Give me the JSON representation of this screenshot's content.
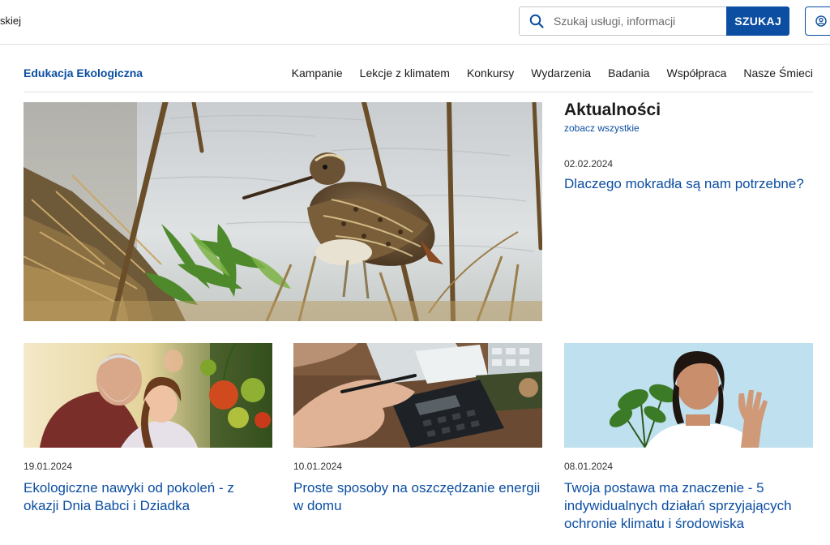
{
  "header": {
    "site_fragment": "skiej",
    "search": {
      "placeholder": "Szukaj usługi, informacji",
      "button_label": "SZUKAJ"
    }
  },
  "nav": {
    "brand": "Edukacja Ekologiczna",
    "items": [
      {
        "label": "Kampanie"
      },
      {
        "label": "Lekcje z klimatem"
      },
      {
        "label": "Konkursy"
      },
      {
        "label": "Wydarzenia"
      },
      {
        "label": "Badania"
      },
      {
        "label": "Współpraca"
      },
      {
        "label": "Nasze Śmieci"
      }
    ]
  },
  "news": {
    "heading": "Aktualności",
    "see_all": "zobacz wszystkie",
    "featured": {
      "date": "02.02.2024",
      "title": "Dlaczego mokradła są nam potrzebne?"
    }
  },
  "articles": [
    {
      "date": "19.01.2024",
      "title": "Ekologiczne nawyki od pokoleń - z okazji Dnia Babci i Dziadka"
    },
    {
      "date": "10.01.2024",
      "title": "Proste sposoby na oszczędzanie energii w domu"
    },
    {
      "date": "08.01.2024",
      "title": "Twoja postawa ma znaczenie - 5 indywidualnych działań sprzyjających ochronie klimatu i środowiska"
    }
  ],
  "colors": {
    "accent": "#0b4ea2",
    "text": "#1b1b1b",
    "divider": "#e3e3e3"
  },
  "icons": {
    "search": "search-icon",
    "account": "user-circle-icon"
  }
}
